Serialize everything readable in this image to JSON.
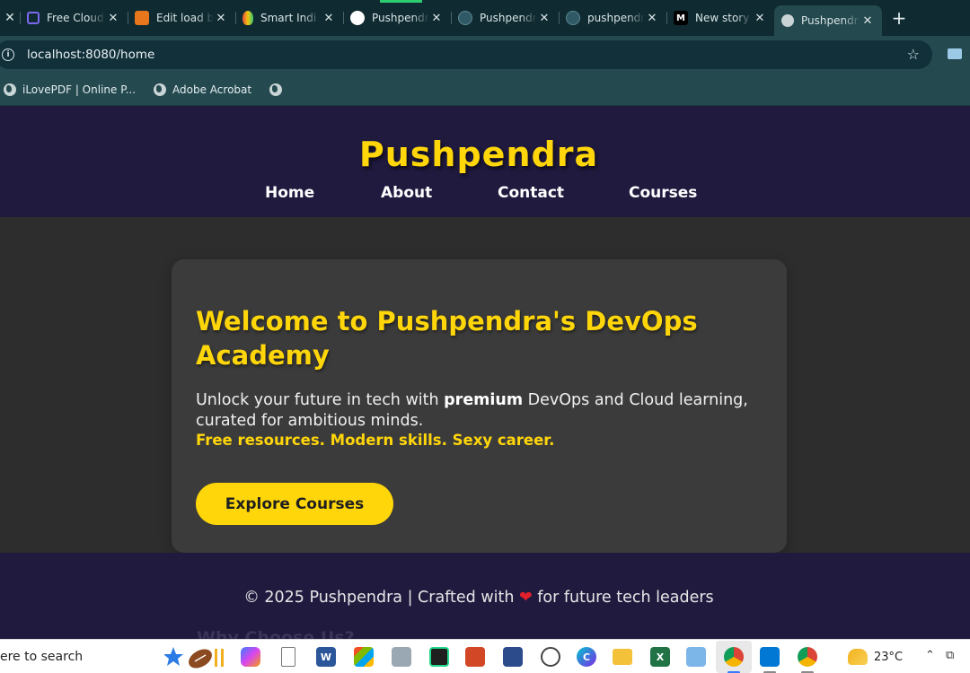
{
  "browser": {
    "tabs": [
      {
        "title": "Free Cloud",
        "favicon": "cube-icon",
        "color": "#7b68ee"
      },
      {
        "title": "Edit load b",
        "favicon": "aws-icon",
        "color": "#e8761c"
      },
      {
        "title": "Smart Indi",
        "favicon": "balloon-icon",
        "color": "#4caf50"
      },
      {
        "title": "Pushpendr",
        "favicon": "github-icon",
        "color": "#ffffff"
      },
      {
        "title": "Pushpendr",
        "favicon": "logo-icon",
        "color": "#2f5965"
      },
      {
        "title": "pushpendr",
        "favicon": "logo-icon",
        "color": "#2f5965"
      },
      {
        "title": "New story",
        "favicon": "medium-icon",
        "color": "#000000",
        "favicon_text": "M"
      },
      {
        "title": "Pushpendr",
        "favicon": "globe-icon",
        "color": "#c9d4d6",
        "active": true
      }
    ],
    "url": "localhost:8080/home",
    "bookmarks": [
      {
        "label": "iLovePDF | Online P..."
      },
      {
        "label": "Adobe Acrobat"
      },
      {
        "label": ""
      }
    ]
  },
  "site": {
    "brand": "Pushpendra",
    "nav": [
      "Home",
      "About",
      "Contact",
      "Courses"
    ],
    "hero": {
      "title": "Welcome to Pushpendra's DevOps Academy",
      "lead_before": "Unlock your future in tech with ",
      "lead_bold": "premium",
      "lead_after": " DevOps and Cloud learning, curated for ambitious minds.",
      "tagline": "Free resources. Modern skills. Sexy career.",
      "cta": "Explore Courses"
    },
    "footer": {
      "text_before": "© 2025 Pushpendra | Crafted with ",
      "heart": "❤",
      "text_after": " for future tech leaders",
      "hidden_heading": "Why Choose Us?"
    },
    "colors": {
      "accent": "#ffd60a",
      "header_bg": "#201a3f",
      "card_bg": "#3b3b3b"
    }
  },
  "taskbar": {
    "search_text": "ere to search",
    "weather": "23°C",
    "apps": [
      "copilot-icon",
      "file-icon",
      "word-icon",
      "store-icon",
      "app-icon",
      "ide-icon",
      "pdf-icon",
      "window-icon",
      "chatgpt-icon",
      "canva-icon",
      "folder-icon",
      "excel-icon",
      "notes-icon",
      "chrome-icon",
      "vscode-icon",
      "chrome-icon"
    ]
  }
}
